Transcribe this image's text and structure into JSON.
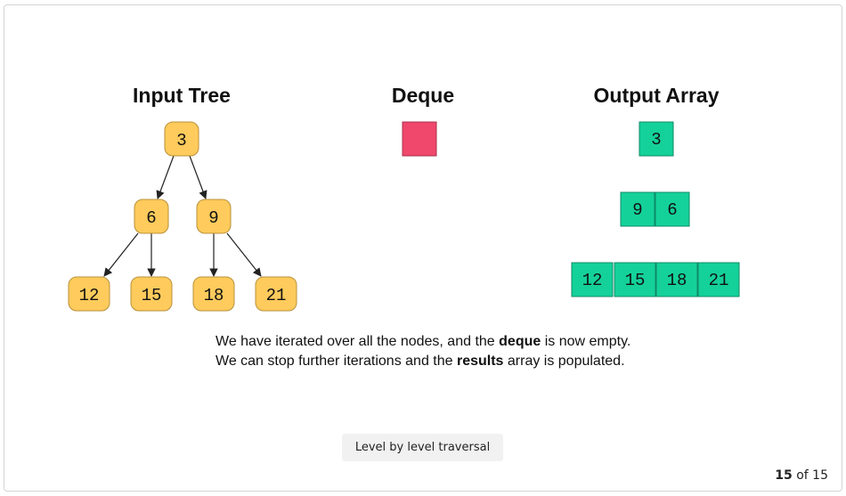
{
  "headings": {
    "tree": "Input Tree",
    "deque": "Deque",
    "output": "Output Array"
  },
  "tree": {
    "root": "3",
    "level1": [
      "6",
      "9"
    ],
    "level2": [
      "12",
      "15",
      "18",
      "21"
    ]
  },
  "deque": {
    "state": "empty"
  },
  "output": {
    "rows": [
      [
        "3"
      ],
      [
        "9",
        "6"
      ],
      [
        "12",
        "15",
        "18",
        "21"
      ]
    ]
  },
  "caption": {
    "line1_pre": "We have iterated over all the nodes, and the ",
    "line1_bold": "deque",
    "line1_post": " is now empty.",
    "line2_pre": "We can stop further iterations and the ",
    "line2_bold": "results",
    "line2_post": " array is populated."
  },
  "slide_label": "Level by level traversal",
  "counter": {
    "current": "15",
    "separator": "of",
    "total": "15"
  },
  "colors": {
    "tree_node": "#fecb5c",
    "deque_box": "#f0476c",
    "output_cell": "#14d19a"
  }
}
